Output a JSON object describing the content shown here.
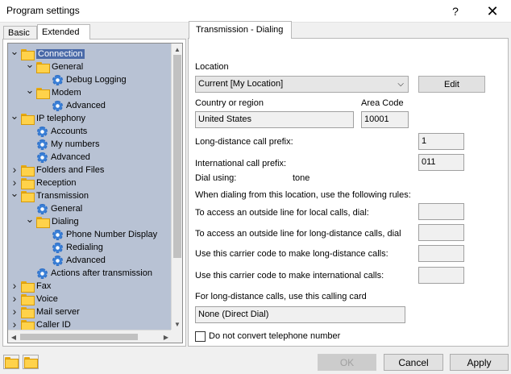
{
  "window": {
    "title": "Program settings",
    "help_glyph": "?",
    "close_glyph": "✕"
  },
  "left_tabs": [
    {
      "label": "Basic",
      "active": false
    },
    {
      "label": "Extended",
      "active": true
    }
  ],
  "tree": {
    "items": [
      {
        "label": "Connection",
        "level": 0,
        "icon": "folder-icon",
        "expanded": true,
        "has_children": true,
        "selected": true
      },
      {
        "label": "General",
        "level": 1,
        "icon": "folder-icon",
        "expanded": true,
        "has_children": true
      },
      {
        "label": "Debug Logging",
        "level": 2,
        "icon": "gear-icon",
        "has_children": false
      },
      {
        "label": "Modem",
        "level": 1,
        "icon": "folder-icon",
        "expanded": true,
        "has_children": true
      },
      {
        "label": "Advanced",
        "level": 2,
        "icon": "gear-icon",
        "has_children": false
      },
      {
        "label": "IP telephony",
        "level": 0,
        "icon": "folder-icon",
        "expanded": true,
        "has_children": true
      },
      {
        "label": "Accounts",
        "level": 1,
        "icon": "gear-icon",
        "has_children": false
      },
      {
        "label": "My numbers",
        "level": 1,
        "icon": "gear-icon",
        "has_children": false
      },
      {
        "label": "Advanced",
        "level": 1,
        "icon": "gear-icon",
        "has_children": false
      },
      {
        "label": "Folders and Files",
        "level": 0,
        "icon": "folder-icon",
        "expanded": false,
        "has_children": true
      },
      {
        "label": "Reception",
        "level": 0,
        "icon": "folder-icon",
        "expanded": false,
        "has_children": true
      },
      {
        "label": "Transmission",
        "level": 0,
        "icon": "folder-icon",
        "expanded": true,
        "has_children": true
      },
      {
        "label": "General",
        "level": 1,
        "icon": "gear-icon",
        "has_children": false
      },
      {
        "label": "Dialing",
        "level": 1,
        "icon": "folder-icon",
        "expanded": true,
        "has_children": true
      },
      {
        "label": "Phone Number Display",
        "level": 2,
        "icon": "gear-icon",
        "has_children": false
      },
      {
        "label": "Redialing",
        "level": 2,
        "icon": "gear-icon",
        "has_children": false
      },
      {
        "label": "Advanced",
        "level": 2,
        "icon": "gear-icon",
        "has_children": false
      },
      {
        "label": "Actions after transmission",
        "level": 1,
        "icon": "gear-icon",
        "has_children": false
      },
      {
        "label": "Fax",
        "level": 0,
        "icon": "folder-icon",
        "expanded": false,
        "has_children": true
      },
      {
        "label": "Voice",
        "level": 0,
        "icon": "folder-icon",
        "expanded": false,
        "has_children": true
      },
      {
        "label": "Mail server",
        "level": 0,
        "icon": "folder-icon",
        "expanded": false,
        "has_children": true
      },
      {
        "label": "Caller ID",
        "level": 0,
        "icon": "folder-icon",
        "expanded": false,
        "has_children": true
      }
    ]
  },
  "panel": {
    "tab_label": "Transmission - Dialing",
    "location_label": "Location",
    "location_value": "Current [My Location]",
    "edit_button": "Edit",
    "country_label": "Country or region",
    "country_value": "United States",
    "area_code_label": "Area Code",
    "area_code_value": "10001",
    "long_distance_prefix_label": "Long-distance call prefix:",
    "long_distance_prefix_value": "1",
    "international_prefix_label": "International call prefix:",
    "international_prefix_value": "011",
    "dial_using_label": "Dial using:",
    "dial_using_value": "tone",
    "rules_label": "When dialing from this location, use the following rules:",
    "outside_local_label": "To access an outside line for local calls, dial:",
    "outside_local_value": "",
    "outside_long_label": "To access an outside line for long-distance calls, dial",
    "outside_long_value": "",
    "carrier_long_label": "Use this carrier code to make long-distance calls:",
    "carrier_long_value": "",
    "carrier_intl_label": "Use this carrier code to make international calls:",
    "carrier_intl_value": "",
    "calling_card_label": "For long-distance calls, use this calling card",
    "calling_card_value": "None (Direct Dial)",
    "no_convert_label": "Do not convert telephone number",
    "no_convert_checked": false
  },
  "footer": {
    "ok_label": "OK",
    "cancel_label": "Cancel",
    "apply_label": "Apply"
  }
}
